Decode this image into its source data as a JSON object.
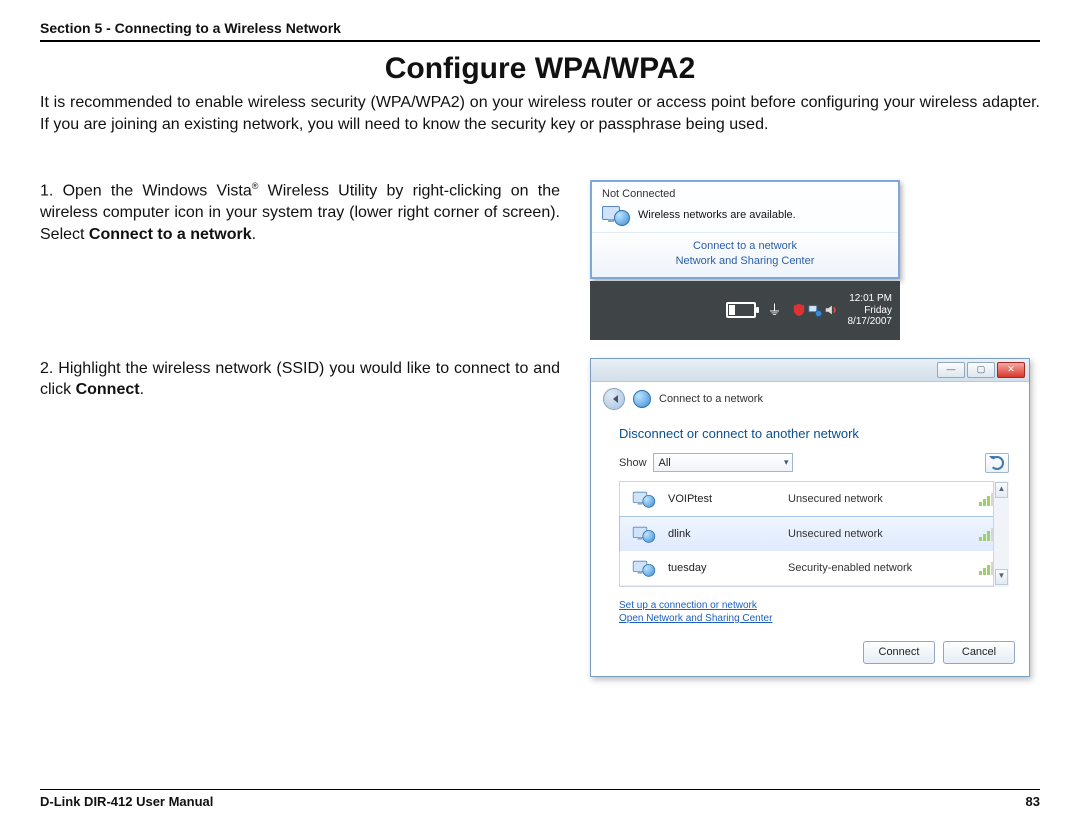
{
  "header": {
    "section": "Section 5 - Connecting to a Wireless Network"
  },
  "title": "Configure WPA/WPA2",
  "intro": "It is recommended to enable wireless security (WPA/WPA2) on your wireless router or access point before configuring your wireless adapter. If you are joining an existing network, you will need to know the security key or passphrase being used.",
  "steps": {
    "one": {
      "num": "1.",
      "pre": "Open the Windows Vista",
      "reg": "®",
      "mid": " Wireless Utility by right-clicking on the wireless computer icon in your system tray (lower right corner of screen). Select ",
      "bold": "Connect to a network",
      "post": "."
    },
    "two": {
      "num": "2.",
      "pre": "Highlight the wireless network (SSID) you would like to connect to and click ",
      "bold": "Connect",
      "post": "."
    }
  },
  "popup": {
    "nc_title": "Not Connected",
    "nc_msg": "Wireless networks are available.",
    "link1": "Connect to a network",
    "link2": "Network and Sharing Center"
  },
  "tray": {
    "time": "12:01 PM",
    "day": "Friday",
    "date": "8/17/2007"
  },
  "dialog": {
    "breadcrumb": "Connect to a network",
    "instruction": "Disconnect or connect to another network",
    "show_label": "Show",
    "show_value": "All",
    "networks": [
      {
        "name": "VOIPtest",
        "sec": "Unsecured network"
      },
      {
        "name": "dlink",
        "sec": "Unsecured network"
      },
      {
        "name": "tuesday",
        "sec": "Security-enabled network"
      }
    ],
    "link1": "Set up a connection or network",
    "link2": "Open Network and Sharing Center",
    "connect": "Connect",
    "cancel": "Cancel"
  },
  "footer": {
    "manual": "D-Link DIR-412 User Manual",
    "page": "83"
  }
}
